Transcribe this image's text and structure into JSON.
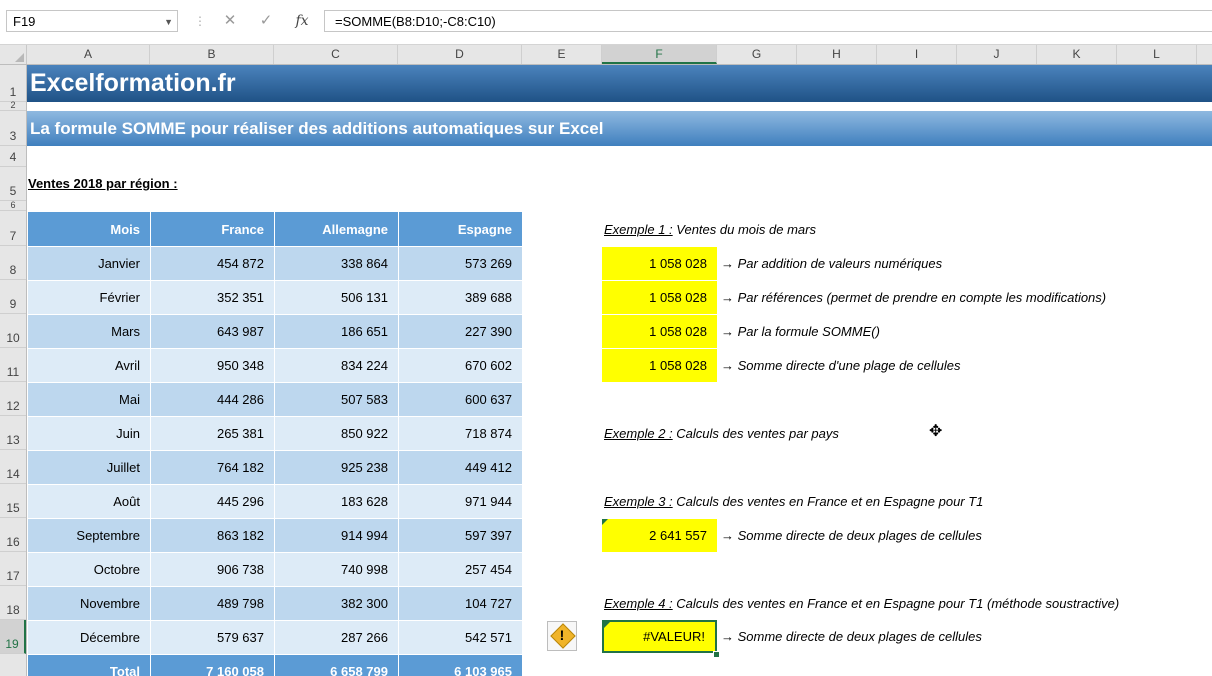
{
  "formula_bar": {
    "name_box": "F19",
    "cancel_icon": "✕",
    "enter_icon": "✓",
    "fx_label": "fx",
    "formula": "=SOMME(B8:D10;-C8:C10)"
  },
  "columns": [
    "A",
    "B",
    "C",
    "D",
    "E",
    "F",
    "G",
    "H",
    "I",
    "J",
    "K",
    "L"
  ],
  "selected_column": "F",
  "rows": [
    "1",
    "2",
    "3",
    "4",
    "5",
    "6",
    "7",
    "8",
    "9",
    "10",
    "11",
    "12",
    "13",
    "14",
    "15",
    "16",
    "17",
    "18",
    "19"
  ],
  "selected_row": "19",
  "banner": "Excelformation.fr",
  "title": "La formule SOMME pour réaliser des additions automatiques sur Excel",
  "subtitle": "Ventes 2018 par région :",
  "table": {
    "headers": [
      "Mois",
      "France",
      "Allemagne",
      "Espagne"
    ],
    "rows": [
      [
        "Janvier",
        "454 872",
        "338 864",
        "573 269"
      ],
      [
        "Février",
        "352 351",
        "506 131",
        "389 688"
      ],
      [
        "Mars",
        "643 987",
        "186 651",
        "227 390"
      ],
      [
        "Avril",
        "950 348",
        "834 224",
        "670 602"
      ],
      [
        "Mai",
        "444 286",
        "507 583",
        "600 637"
      ],
      [
        "Juin",
        "265 381",
        "850 922",
        "718 874"
      ],
      [
        "Juillet",
        "764 182",
        "925 238",
        "449 412"
      ],
      [
        "Août",
        "445 296",
        "183 628",
        "971 944"
      ],
      [
        "Septembre",
        "863 182",
        "914 994",
        "597 397"
      ],
      [
        "Octobre",
        "906 738",
        "740 998",
        "257 454"
      ],
      [
        "Novembre",
        "489 798",
        "382 300",
        "104 727"
      ],
      [
        "Décembre",
        "579 637",
        "287 266",
        "542 571"
      ]
    ],
    "total": [
      "Total",
      "7 160 058",
      "6 658 799",
      "6 103 965"
    ]
  },
  "examples": {
    "ex1": {
      "label": "Exemple 1 :",
      "text": "Ventes du mois de mars"
    },
    "ex1_cells": [
      {
        "value": "1 058 028",
        "note": "→ Par addition de valeurs numériques"
      },
      {
        "value": "1 058 028",
        "note": "→ Par références (permet de prendre en compte les modifications)"
      },
      {
        "value": "1 058 028",
        "note": "→ Par la formule SOMME()"
      },
      {
        "value": "1 058 028",
        "note": "→ Somme directe d'une plage de cellules"
      }
    ],
    "ex2": {
      "label": "Exemple 2 :",
      "text": "Calculs des ventes par pays"
    },
    "ex3": {
      "label": "Exemple 3 :",
      "text": "Calculs des ventes en France et en Espagne pour T1"
    },
    "ex3_cell": {
      "value": "2 641 557",
      "note": "→ Somme directe de deux plages de cellules"
    },
    "ex4": {
      "label": "Exemple 4 :",
      "text": "Calculs des ventes en France et en Espagne pour T1 (méthode soustractive)"
    },
    "ex4_cell": {
      "value": "#VALEUR!",
      "note": "→ Somme directe de deux plages de cellules"
    }
  },
  "colors": {
    "header_blue": "#5b9bd5",
    "row_dark": "#bdd7ee",
    "row_light": "#ddebf7",
    "highlight": "#ffff00",
    "excel_green": "#217346"
  }
}
